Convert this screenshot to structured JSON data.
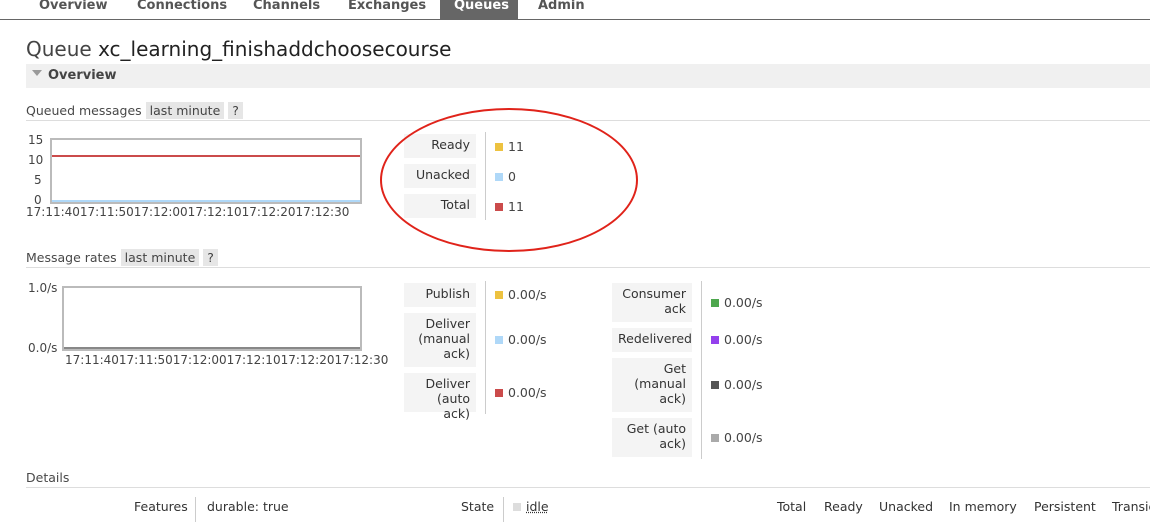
{
  "nav": {
    "tabs": [
      "Overview",
      "Connections",
      "Channels",
      "Exchanges",
      "Queues",
      "Admin"
    ],
    "active": "Queues"
  },
  "page": {
    "title_prefix": "Queue",
    "queue_name": "xc_learning_finishaddchoosecourse",
    "overview_label": "Overview"
  },
  "queued": {
    "heading": "Queued messages",
    "range": "last minute",
    "help": "?",
    "y_ticks": [
      "15",
      "10",
      "5",
      "0"
    ],
    "x_ticks_text": "17:11:4017:11:5017:12:0017:12:1017:12:2017:12:30",
    "legend": [
      {
        "label": "Ready",
        "value": "11",
        "color": "#edc240"
      },
      {
        "label": "Unacked",
        "value": "0",
        "color": "#afd8f8"
      },
      {
        "label": "Total",
        "value": "11",
        "color": "#cb4b4b"
      }
    ]
  },
  "rates": {
    "heading": "Message rates",
    "range": "last minute",
    "help": "?",
    "y_ticks": [
      "1.0/s",
      "0.0/s"
    ],
    "x_ticks_text": "17:11:4017:11:5017:12:0017:12:1017:12:2017:12:30",
    "left_legend": [
      {
        "label": "Publish",
        "value": "0.00/s",
        "color": "#edc240"
      },
      {
        "label": "Deliver (manual ack)",
        "value": "0.00/s",
        "color": "#afd8f8"
      },
      {
        "label": "Deliver (auto ack)",
        "value": "0.00/s",
        "color": "#cb4b4b"
      }
    ],
    "right_legend": [
      {
        "label": "Consumer ack",
        "value": "0.00/s",
        "color": "#4da74d"
      },
      {
        "label": "Redelivered",
        "value": "0.00/s",
        "color": "#9440ed"
      },
      {
        "label": "Get (manual ack)",
        "value": "0.00/s",
        "color": "#555555"
      },
      {
        "label": "Get (auto ack)",
        "value": "0.00/s",
        "color": "#aaaaaa"
      }
    ]
  },
  "details": {
    "heading": "Details",
    "features_label": "Features",
    "features_value": "durable: true",
    "state_label": "State",
    "state_value": "idle",
    "columns": [
      "Total",
      "Ready",
      "Unacked",
      "In memory",
      "Persistent",
      "Transie"
    ]
  },
  "chart_data": [
    {
      "type": "line",
      "x": [
        "17:11:40",
        "17:11:50",
        "17:12:00",
        "17:12:10",
        "17:12:20",
        "17:12:30"
      ],
      "series": [
        {
          "name": "Ready",
          "values": [
            11,
            11,
            11,
            11,
            11,
            11
          ]
        },
        {
          "name": "Unacked",
          "values": [
            0,
            0,
            0,
            0,
            0,
            0
          ]
        },
        {
          "name": "Total",
          "values": [
            11,
            11,
            11,
            11,
            11,
            11
          ]
        }
      ],
      "ylim": [
        0,
        15
      ]
    },
    {
      "type": "line",
      "x": [
        "17:11:40",
        "17:11:50",
        "17:12:00",
        "17:12:10",
        "17:12:20",
        "17:12:30"
      ],
      "series": [
        {
          "name": "Publish",
          "values": [
            0,
            0,
            0,
            0,
            0,
            0
          ]
        },
        {
          "name": "Deliver (manual ack)",
          "values": [
            0,
            0,
            0,
            0,
            0,
            0
          ]
        },
        {
          "name": "Deliver (auto ack)",
          "values": [
            0,
            0,
            0,
            0,
            0,
            0
          ]
        }
      ],
      "ylim": [
        0,
        1
      ]
    }
  ]
}
